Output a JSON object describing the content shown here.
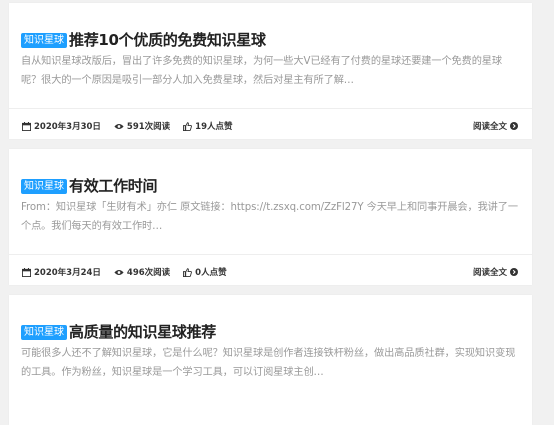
{
  "posts": [
    {
      "tag": "知识星球",
      "title": "推荐10个优质的免费知识星球",
      "excerpt": "自从知识星球改版后，冒出了许多免费的知识星球，为何一些大V已经有了付费的星球还要建一个免费的星球呢？很大的一个原因是吸引一部分人加入免费星球，然后对星主有所了解…",
      "date": "2020年3月30日",
      "views": "591次阅读",
      "likes": "19人点赞",
      "read_more": "阅读全文"
    },
    {
      "tag": "知识星球",
      "title": "有效工作时间",
      "excerpt": "From：知识星球「生财有术」亦仁 原文链接：https://t.zsxq.com/ZzFl27Y 今天早上和同事开晨会，我讲了一个点。我们每天的有效工作时…",
      "date": "2020年3月24日",
      "views": "496次阅读",
      "likes": "0人点赞",
      "read_more": "阅读全文"
    },
    {
      "tag": "知识星球",
      "title": "高质量的知识星球推荐",
      "excerpt": "可能很多人还不了解知识星球，它是什么呢？知识星球是创作者连接铁杆粉丝，做出高品质社群，实现知识变现的工具。作为粉丝，知识星球是一个学习工具，可以订阅星球主创…"
    }
  ],
  "icons": {
    "calendar": "calendar-icon",
    "views": "eye-icon",
    "likes": "thumbs-up-icon",
    "read_more": "chevron-right-circle-icon"
  },
  "colors": {
    "tag_bg": "#1e9fff",
    "title": "#222222",
    "excerpt": "#999999",
    "background": "#f1f1f1"
  }
}
